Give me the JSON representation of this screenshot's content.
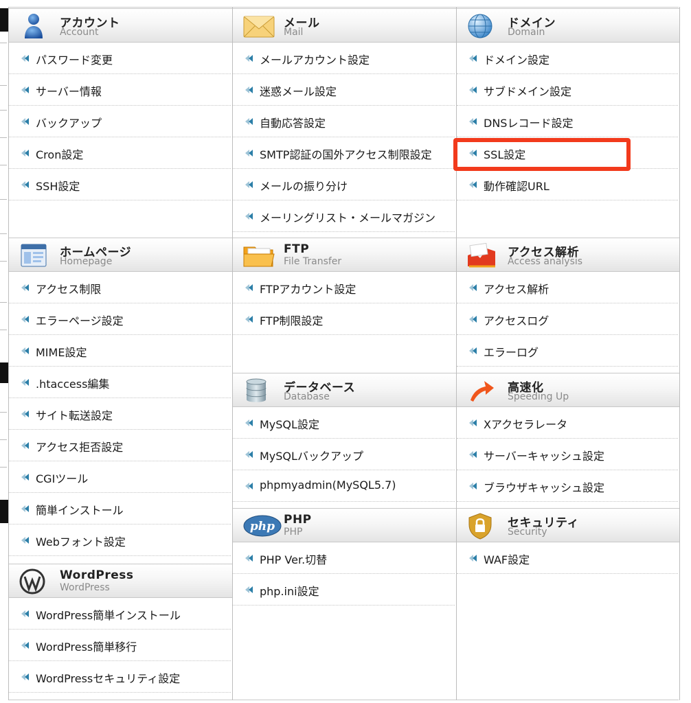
{
  "columns": [
    {
      "sections": [
        {
          "title": "アカウント",
          "subtitle": "Account",
          "icon": "account-icon",
          "items": [
            "パスワード変更",
            "サーバー情報",
            "バックアップ",
            "Cron設定",
            "SSH設定"
          ]
        },
        {
          "title": "ホームページ",
          "subtitle": "Homepage",
          "icon": "homepage-icon",
          "items": [
            "アクセス制限",
            "エラーページ設定",
            "MIME設定",
            ".htaccess編集",
            "サイト転送設定",
            "アクセス拒否設定",
            "CGIツール",
            "簡単インストール",
            "Webフォント設定"
          ]
        },
        {
          "title": "WordPress",
          "subtitle": "WordPress",
          "icon": "wordpress-icon",
          "items": [
            "WordPress簡単インストール",
            "WordPress簡単移行",
            "WordPressセキュリティ設定"
          ]
        }
      ]
    },
    {
      "sections": [
        {
          "title": "メール",
          "subtitle": "Mail",
          "icon": "mail-icon",
          "items": [
            "メールアカウント設定",
            "迷惑メール設定",
            "自動応答設定",
            "SMTP認証の国外アクセス制限設定",
            "メールの振り分け",
            "メーリングリスト・メールマガジン"
          ]
        },
        {
          "title": "FTP",
          "subtitle": "File Transfer",
          "icon": "folder-icon",
          "items": [
            "FTPアカウント設定",
            "FTP制限設定"
          ]
        },
        {
          "title": "データベース",
          "subtitle": "Database",
          "icon": "database-icon",
          "items": [
            "MySQL設定",
            "MySQLバックアップ",
            "phpmyadmin(MySQL5.7)"
          ]
        },
        {
          "title": "PHP",
          "subtitle": "PHP",
          "icon": "php-icon",
          "items": [
            "PHP Ver.切替",
            "php.ini設定"
          ]
        }
      ]
    },
    {
      "sections": [
        {
          "title": "ドメイン",
          "subtitle": "Domain",
          "icon": "globe-icon",
          "items": [
            "ドメイン設定",
            "サブドメイン設定",
            "DNSレコード設定",
            "SSL設定",
            "動作確認URL"
          ]
        },
        {
          "title": "アクセス解析",
          "subtitle": "Access analysis",
          "icon": "chart-icon",
          "items": [
            "アクセス解析",
            "アクセスログ",
            "エラーログ"
          ]
        },
        {
          "title": "高速化",
          "subtitle": "Speeding Up",
          "icon": "speed-arrow-icon",
          "items": [
            "Xアクセラレータ",
            "サーバーキャッシュ設定",
            "ブラウザキャッシュ設定"
          ]
        },
        {
          "title": "セキュリティ",
          "subtitle": "Security",
          "icon": "security-shield-icon",
          "items": [
            "WAF設定"
          ]
        }
      ]
    }
  ],
  "highlighted_item": "SSL設定",
  "colors": {
    "highlight": "#f23a1c",
    "arrow": "#2c7fa8",
    "text": "#1a1a1a",
    "subtitle": "#8a8a8a"
  }
}
